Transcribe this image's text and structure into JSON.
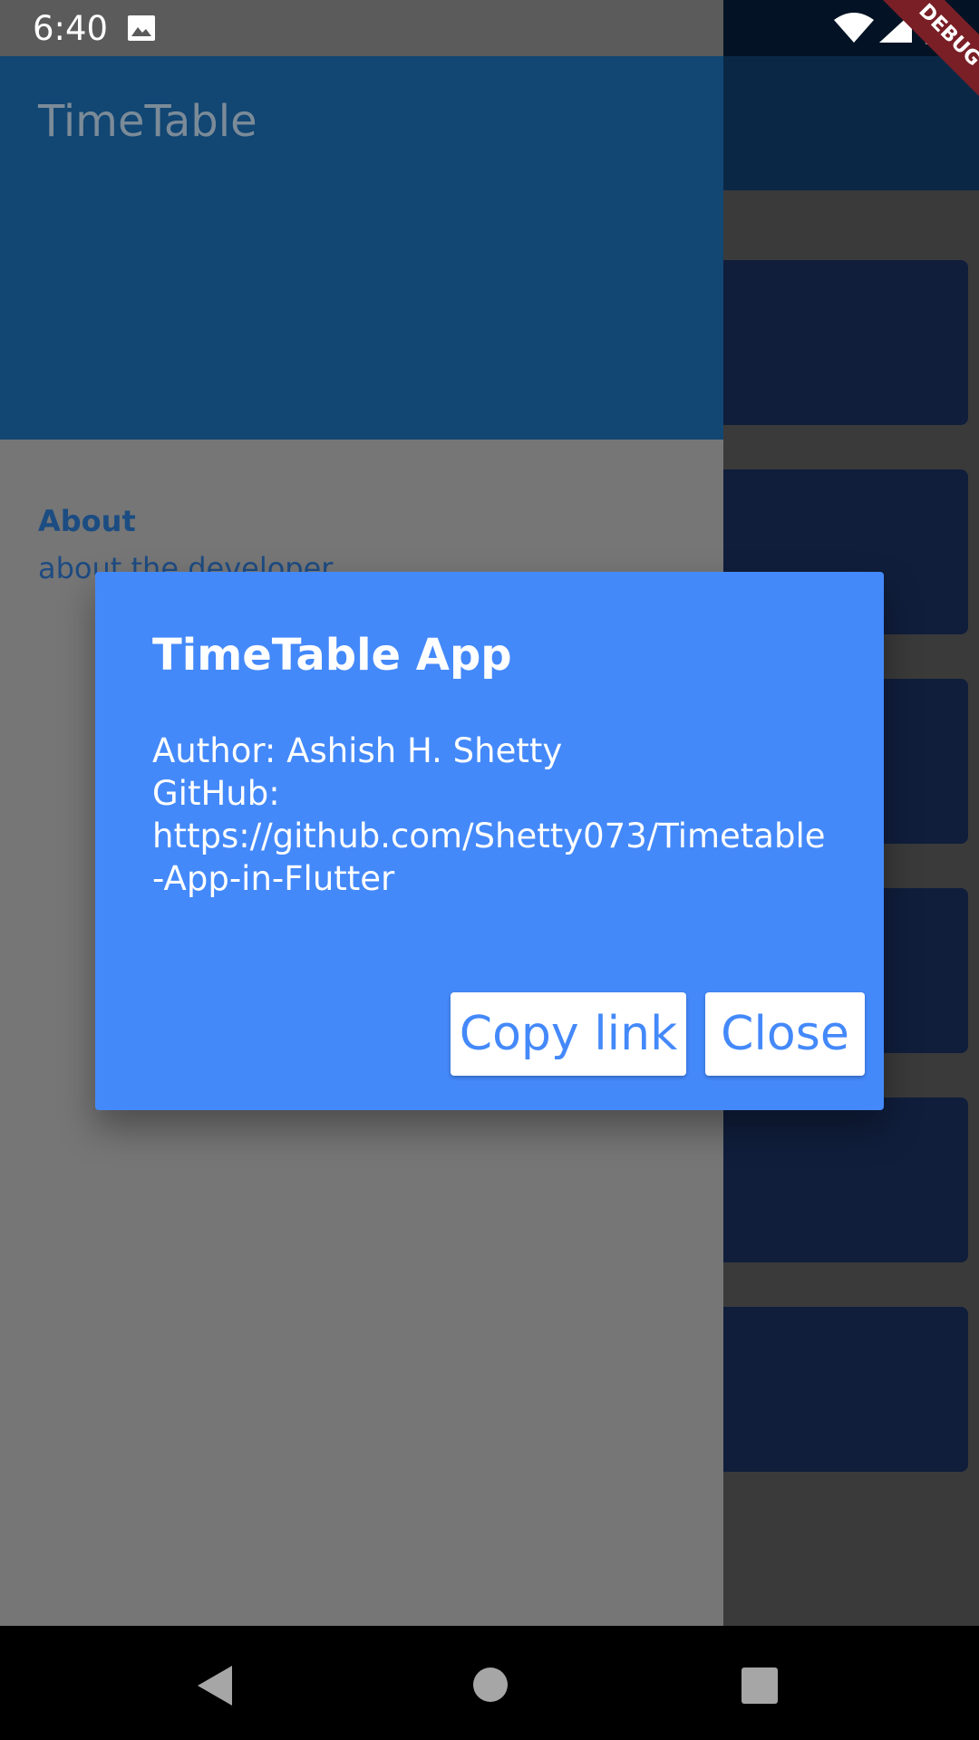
{
  "status_bar": {
    "time": "6:40",
    "icons": [
      "gallery-icon",
      "wifi-icon",
      "signal-icon",
      "battery-charging-icon"
    ]
  },
  "debug_banner": "DEBUG",
  "drawer": {
    "title": "TimeTable",
    "items": [
      {
        "title": "About",
        "subtitle": "about the developer"
      }
    ]
  },
  "dialog": {
    "title": "TimeTable App",
    "body": "Author: Ashish H. Shetty\nGitHub:\nhttps://github.com/Shetty073/Timetable\n-App-in-Flutter",
    "copy_label": "Copy link",
    "close_label": "Close"
  },
  "colors": {
    "dialog_bg": "#4489fa",
    "drawer_header": "#124673",
    "scrim": "#767676",
    "button_text": "#4489fa"
  },
  "nav_bar": {
    "icons": [
      "back-icon",
      "home-icon",
      "recents-icon"
    ]
  }
}
